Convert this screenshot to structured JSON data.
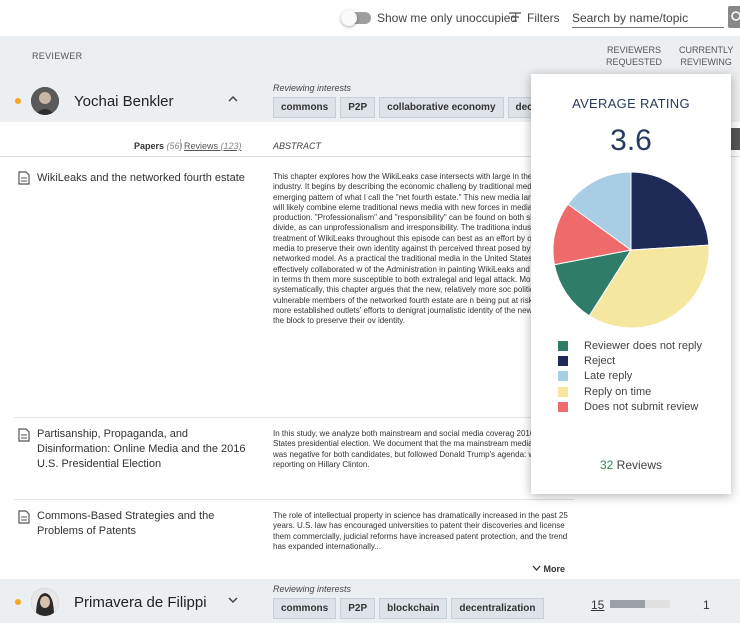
{
  "toolbar": {
    "unoccupied_label": "Show me only unoccupied",
    "filters_label": "Filters",
    "search_placeholder": "Search by name/topic"
  },
  "table_header": {
    "reviewer": "REVIEWER",
    "requested_1": "REVIEWERS",
    "requested_2": "REQUESTED",
    "currently_1": "CURRENTLY",
    "currently_2": "REVIEWING"
  },
  "reviewers": [
    {
      "name": "Yochai Benkler",
      "interests_label": "Reviewing interests",
      "tags": [
        "commons",
        "P2P",
        "collaborative economy",
        "decentrali"
      ]
    },
    {
      "name": "Primavera de Filippi",
      "interests_label": "Reviewing interests",
      "tags": [
        "commons",
        "P2P",
        "blockchain",
        "decentralization"
      ],
      "requested": "15",
      "progress": 0.58,
      "currently": "1"
    }
  ],
  "papers_section": {
    "papers_label": "Papers",
    "papers_count": "(56)",
    "reviews_label": "Reviews",
    "reviews_count": "(123)",
    "abstract_label": "ABSTRACT",
    "more_label": "More"
  },
  "papers": [
    {
      "title": "WikiLeaks and the networked fourth estate",
      "abstract": "This chapter explores how the WikiLeaks case intersects with large in the news industry. It begins by describing the economic challeng by traditional media and the emerging pattern of what I call the \"net fourth estate.\" This new media landscape will likely combine eleme traditional news media with new forces in media production. \"Professionalism\" and \"responsibility\" can be found on both sides o divide, as can unprofessionalism and irresponsibility. The traditiona industry's treatment of WikiLeaks throughout this episode can best as an effort by older media to preserve their own identity against th perceived threat posed by the new networked model. As a practical the traditional media in the United States effectively collaborated w of the Administration in painting WikiLeaks and Assange in terms th them more susceptible to both extralegal and legal attack. More systematically, this chapter argues that the new, relatively more soc politically vulnerable members of the networked fourth estate are n being put at risk by the more established outlets' efforts to denigrat journalistic identity of the new kids on the block to preserve their ov identity."
    },
    {
      "title": "Partisanship, Propaganda, and Disinformation: Online Media and the 2016 U.S. Presidential Election",
      "abstract": "In this study, we analyze both mainstream and social media coverag 2016 United States presidential election. We document that the ma mainstream media coverage was negative for both candidates, but followed Donald Trump's agenda: when reporting on Hillary Clinton."
    },
    {
      "title": "Commons-Based Strategies and the Problems of Patents",
      "abstract": "The role of intellectual property in science has dramatically increased in the past 25 years. U.S. law has encouraged universities to patent their discoveries and license them commercially, judicial reforms have increased patent protection, and the trend has expanded internationally..."
    }
  ],
  "rating_popup": {
    "title": "AVERAGE RATING",
    "value": "3.6",
    "reviews_count": "32",
    "reviews_label": "Reviews"
  },
  "chart_data": {
    "type": "pie",
    "title": "AVERAGE RATING",
    "slices": [
      {
        "name": "Reject",
        "value": 24,
        "color": "#1f2a56"
      },
      {
        "name": "Reply on time",
        "value": 35,
        "color": "#f6e7a0"
      },
      {
        "name": "Reviewer does not reply",
        "value": 13,
        "color": "#2f7d68"
      },
      {
        "name": "Does not submit review",
        "value": 13,
        "color": "#ef6a6a"
      },
      {
        "name": "Late reply",
        "value": 15,
        "color": "#a9cde4"
      }
    ],
    "legend_order": [
      "Reviewer does not reply",
      "Reject",
      "Late reply",
      "Reply on time",
      "Does not submit review"
    ],
    "legend_position": "bottom"
  },
  "colors": {
    "accent_dot": "#f5a623",
    "progress_fill": "#9aa0a6",
    "header_bg": "#eceff1"
  }
}
